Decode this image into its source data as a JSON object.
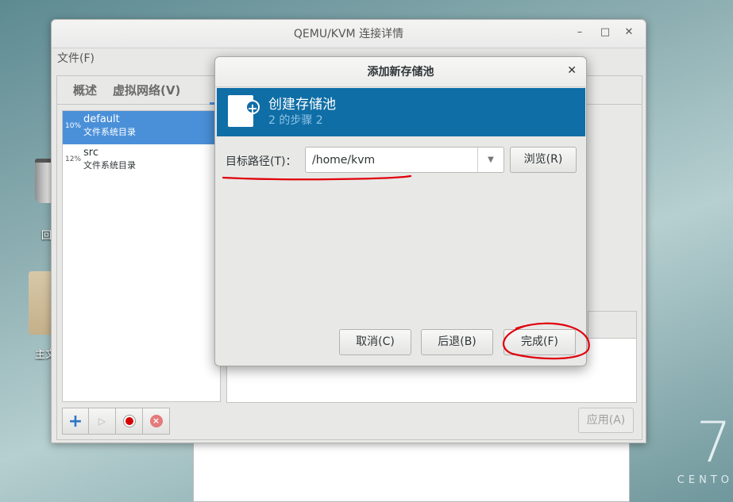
{
  "desktop": {
    "trash_label": "回",
    "home_label": "主文",
    "brand_seven": "7",
    "brand_text": "CENTO"
  },
  "main_window": {
    "title": "QEMU/KVM 连接详情",
    "menu_file": "文件(F)",
    "tabs": [
      {
        "label": "概述"
      },
      {
        "label": "虚拟网络(V)"
      }
    ],
    "pools": [
      {
        "pct": "10%",
        "name": "default",
        "type": "文件系统目录",
        "selected": true
      },
      {
        "pct": "12%",
        "name": "src",
        "type": "文件系统目录",
        "selected": false
      }
    ],
    "apply_label": "应用(A)"
  },
  "dialog": {
    "title": "添加新存储池",
    "header_title": "创建存储池",
    "header_step": "2 的步骤 2",
    "target_path_label": "目标路径(T)：",
    "target_path_value": "/home/kvm",
    "browse_label": "浏览(R)",
    "cancel_label": "取消(C)",
    "back_label": "后退(B)",
    "finish_label": "完成(F)"
  },
  "colors": {
    "header_blue": "#0f6ea6",
    "selection_blue": "#4a90d9",
    "annotation_red": "#e0000a"
  }
}
